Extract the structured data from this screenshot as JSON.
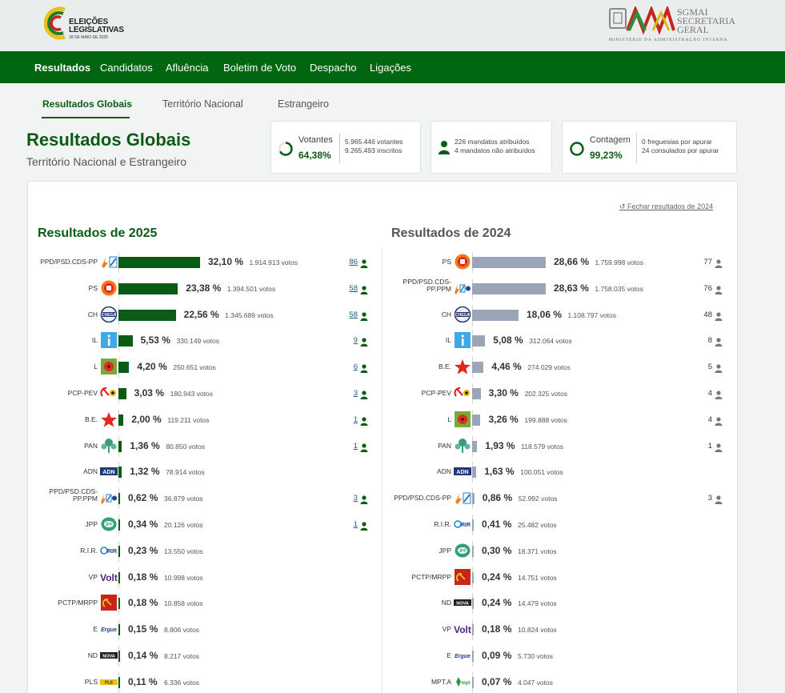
{
  "header": {
    "logo_line1": "ELEIÇÕES",
    "logo_line2": "LEGISLATIVAS",
    "logo_date": "18 DE MAIO DE 2025",
    "org_line1": "SGMAI",
    "org_line2": "SECRETARIA",
    "org_line3": "GERAL",
    "org_ministry": "MINISTÉRIO DA ADMINISTRAÇÃO INTERNA"
  },
  "nav": {
    "items": [
      "Resultados",
      "Candidatos",
      "Afluência",
      "Boletim de Voto",
      "Despacho",
      "Ligações"
    ]
  },
  "subnav": {
    "items": [
      "Resultados Globais",
      "Território Nacional",
      "Estrangeiro"
    ]
  },
  "page": {
    "title": "Resultados Globais",
    "subtitle": "Território Nacional e Estrangeiro"
  },
  "stats": {
    "votantes": {
      "label": "Votantes",
      "value": "64,38%",
      "line1": "5.965.446 votantes",
      "line2": "9.265.493 inscritos"
    },
    "mandatos": {
      "line1": "226 mandatos atribuídos",
      "line2": "4 mandatos não atribuídos"
    },
    "contagem": {
      "label": "Contagem",
      "value": "99,23%",
      "line1": "0 freguesias por apurar",
      "line2": "24 consulados por apurar"
    }
  },
  "compare_link": "Fechar resultados de 2024",
  "colors": {
    "brand_green": "#0a5c15",
    "nav_green": "#006611",
    "bar_2025": "#0a5c15",
    "bar_2024": "#9aa6b8"
  },
  "results_2025": {
    "title": "Resultados de 2025",
    "max_pct": 32.1,
    "rows": [
      {
        "party": "PPD/PSD.CDS-PP",
        "icon": "ad-coalition-icon",
        "pct_value": 32.1,
        "pct": "32,10 %",
        "votes": "1.914.913 votos",
        "seats": "86"
      },
      {
        "party": "PS",
        "icon": "ps-fist-rose-icon",
        "pct_value": 23.38,
        "pct": "23,38 %",
        "votes": "1.394.501 votos",
        "seats": "58"
      },
      {
        "party": "CH",
        "icon": "chega-icon",
        "pct_value": 22.56,
        "pct": "22,56 %",
        "votes": "1.345.689 votos",
        "seats": "58"
      },
      {
        "party": "IL",
        "icon": "il-icon",
        "pct_value": 5.53,
        "pct": "5,53 %",
        "votes": "330.149 votos",
        "seats": "9"
      },
      {
        "party": "L",
        "icon": "livre-poppy-icon",
        "pct_value": 4.2,
        "pct": "4,20 %",
        "votes": "250.651 votos",
        "seats": "6"
      },
      {
        "party": "PCP-PEV",
        "icon": "cdu-hammer-sickle-icon",
        "pct_value": 3.03,
        "pct": "3,03 %",
        "votes": "180.943 votos",
        "seats": "3"
      },
      {
        "party": "B.E.",
        "icon": "be-star-icon",
        "pct_value": 2.0,
        "pct": "2,00 %",
        "votes": "119.211 votos",
        "seats": "1"
      },
      {
        "party": "PAN",
        "icon": "pan-tree-icon",
        "pct_value": 1.36,
        "pct": "1,36 %",
        "votes": "80.850 votos",
        "seats": "1"
      },
      {
        "party": "ADN",
        "icon": "adn-icon",
        "pct_value": 1.32,
        "pct": "1,32 %",
        "votes": "78.914 votos",
        "seats": ""
      },
      {
        "party": "PPD/PSD.CDS-PP.PPM",
        "icon": "ad-ppm-coalition-icon",
        "pct_value": 0.62,
        "pct": "0,62 %",
        "votes": "36.879 votos",
        "seats": "3"
      },
      {
        "party": "JPP",
        "icon": "jpp-icon",
        "pct_value": 0.34,
        "pct": "0,34 %",
        "votes": "20.126 votos",
        "seats": "1"
      },
      {
        "party": "R.I.R.",
        "icon": "rir-icon",
        "pct_value": 0.23,
        "pct": "0,23 %",
        "votes": "13.550 votos",
        "seats": ""
      },
      {
        "party": "VP",
        "icon": "volt-icon",
        "pct_value": 0.18,
        "pct": "0,18 %",
        "votes": "10.998 votos",
        "seats": ""
      },
      {
        "party": "PCTP/MRPP",
        "icon": "pctp-icon",
        "pct_value": 0.18,
        "pct": "0,18 %",
        "votes": "10.858 votos",
        "seats": ""
      },
      {
        "party": "E",
        "icon": "ergue-te-icon",
        "pct_value": 0.15,
        "pct": "0,15 %",
        "votes": "8.806 votos",
        "seats": ""
      },
      {
        "party": "ND",
        "icon": "nova-direita-icon",
        "pct_value": 0.14,
        "pct": "0,14 %",
        "votes": "8.217 votos",
        "seats": ""
      },
      {
        "party": "PLS",
        "icon": "pls-icon",
        "pct_value": 0.11,
        "pct": "0,11 %",
        "votes": "6.336 votos",
        "seats": ""
      }
    ]
  },
  "results_2024": {
    "title": "Resultados de 2024",
    "max_pct": 28.66,
    "rows": [
      {
        "party": "PS",
        "icon": "ps-fist-rose-icon",
        "pct_value": 28.66,
        "pct": "28,66 %",
        "votes": "1.759.998 votos",
        "seats": "77"
      },
      {
        "party": "PPD/PSD.CDS-PP.PPM",
        "icon": "ad-ppm-coalition-icon",
        "pct_value": 28.63,
        "pct": "28,63 %",
        "votes": "1.758.035 votos",
        "seats": "76"
      },
      {
        "party": "CH",
        "icon": "chega-icon",
        "pct_value": 18.06,
        "pct": "18,06 %",
        "votes": "1.108.797 votos",
        "seats": "48"
      },
      {
        "party": "IL",
        "icon": "il-icon",
        "pct_value": 5.08,
        "pct": "5,08 %",
        "votes": "312.064 votos",
        "seats": "8"
      },
      {
        "party": "B.E.",
        "icon": "be-star-icon",
        "pct_value": 4.46,
        "pct": "4,46 %",
        "votes": "274.029 votos",
        "seats": "5"
      },
      {
        "party": "PCP-PEV",
        "icon": "cdu-hammer-sickle-icon",
        "pct_value": 3.3,
        "pct": "3,30 %",
        "votes": "202.325 votos",
        "seats": "4"
      },
      {
        "party": "L",
        "icon": "livre-poppy-icon",
        "pct_value": 3.26,
        "pct": "3,26 %",
        "votes": "199.888 votos",
        "seats": "4"
      },
      {
        "party": "PAN",
        "icon": "pan-tree-icon",
        "pct_value": 1.93,
        "pct": "1,93 %",
        "votes": "118.579 votos",
        "seats": "1"
      },
      {
        "party": "ADN",
        "icon": "adn-icon",
        "pct_value": 1.63,
        "pct": "1,63 %",
        "votes": "100.051 votos",
        "seats": ""
      },
      {
        "party": "PPD/PSD.CDS-PP",
        "icon": "ad-coalition-icon",
        "pct_value": 0.86,
        "pct": "0,86 %",
        "votes": "52.992 votos",
        "seats": "3"
      },
      {
        "party": "R.I.R.",
        "icon": "rir-icon",
        "pct_value": 0.41,
        "pct": "0,41 %",
        "votes": "25.482 votos",
        "seats": ""
      },
      {
        "party": "JPP",
        "icon": "jpp-icon",
        "pct_value": 0.3,
        "pct": "0,30 %",
        "votes": "18.371 votos",
        "seats": ""
      },
      {
        "party": "PCTP/MRPP",
        "icon": "pctp-icon",
        "pct_value": 0.24,
        "pct": "0,24 %",
        "votes": "14.751 votos",
        "seats": ""
      },
      {
        "party": "ND",
        "icon": "nova-direita-icon",
        "pct_value": 0.24,
        "pct": "0,24 %",
        "votes": "14.479 votos",
        "seats": ""
      },
      {
        "party": "VP",
        "icon": "volt-icon",
        "pct_value": 0.18,
        "pct": "0,18 %",
        "votes": "10.824 votos",
        "seats": ""
      },
      {
        "party": "E",
        "icon": "ergue-te-icon",
        "pct_value": 0.09,
        "pct": "0,09 %",
        "votes": "5.730 votos",
        "seats": ""
      },
      {
        "party": "MPT.A",
        "icon": "mpt-icon",
        "pct_value": 0.07,
        "pct": "0,07 %",
        "votes": "4.047 votos",
        "seats": ""
      }
    ]
  }
}
